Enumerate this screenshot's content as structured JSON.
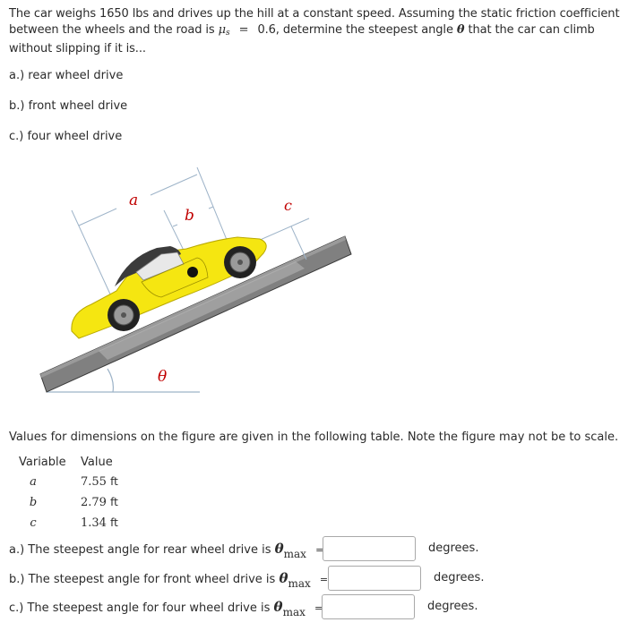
{
  "problem": {
    "text_part1": "The car weighs 1650 lbs and drives up the hill at a constant speed. Assuming the static friction coefficient between the wheels and the road is",
    "mu_symbol": "μ",
    "mu_subscript": "s",
    "equals": "=",
    "mu_value": "0.6, determine the steepest angle",
    "theta_symbol": "θ",
    "text_part2": "that the car can climb without slipping if it is..."
  },
  "parts": [
    {
      "label": "a.) rear wheel drive"
    },
    {
      "label": "b.) front wheel drive"
    },
    {
      "label": "c.) four wheel drive"
    }
  ],
  "figure": {
    "label_a": "a",
    "label_b": "b",
    "label_c": "c",
    "label_theta": "θ",
    "colors": {
      "ramp": "#808080",
      "car_body": "#f5e611",
      "roof": "#3b3b3b",
      "dimension_lines": "#9db3c8",
      "labels": "#c00000"
    }
  },
  "values_note": "Values for dimensions on the figure are given in the following table. Note the figure may not be to scale.",
  "values_table": {
    "headers": [
      "Variable",
      "Value"
    ],
    "rows": [
      {
        "variable": "a",
        "value": "7.55",
        "unit": "ft"
      },
      {
        "variable": "b",
        "value": "2.79",
        "unit": "ft"
      },
      {
        "variable": "c",
        "value": "1.34",
        "unit": "ft"
      }
    ]
  },
  "answers": [
    {
      "prefix": "a.) The steepest angle for rear wheel drive is",
      "theta": "θ",
      "sub": "max",
      "equals": "=",
      "value": "",
      "unit": "degrees."
    },
    {
      "prefix": "b.) The steepest angle for front wheel drive is",
      "theta": "θ",
      "sub": "max",
      "equals": "=",
      "value": "",
      "unit": "degrees."
    },
    {
      "prefix": "c.) The steepest angle for four wheel drive is",
      "theta": "θ",
      "sub": "max",
      "equals": "=",
      "value": "",
      "unit": "degrees."
    }
  ]
}
